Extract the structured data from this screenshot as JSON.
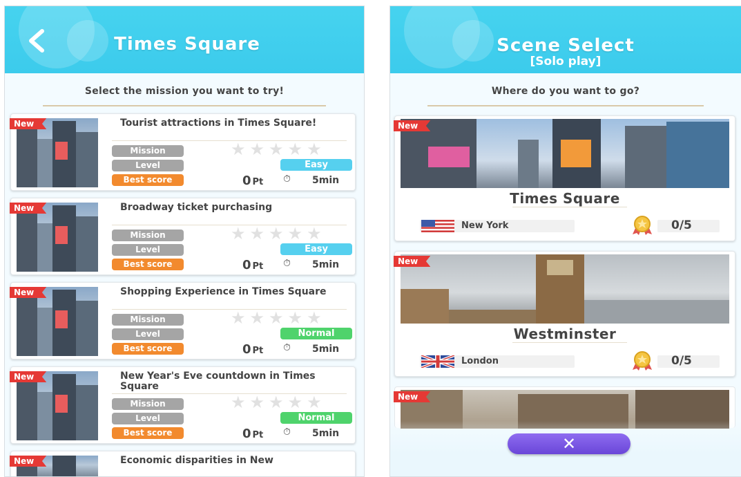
{
  "left_screen": {
    "title": "Times Square",
    "back_icon": "chevron-left-icon",
    "prompt": "Select the mission you want to try!",
    "labels": {
      "mission": "Mission",
      "level": "Level",
      "best_score": "Best score",
      "points_unit": "Pt"
    },
    "new_badge": "New",
    "missions": [
      {
        "title": "Tourist attractions in Times Square!",
        "difficulty": "Easy",
        "score": "0",
        "duration": "5min",
        "stars": 0
      },
      {
        "title": "Broadway ticket purchasing",
        "difficulty": "Easy",
        "score": "0",
        "duration": "5min",
        "stars": 0
      },
      {
        "title": "Shopping Experience in Times Square",
        "difficulty": "Normal",
        "score": "0",
        "duration": "5min",
        "stars": 0
      },
      {
        "title": "New Year's Eve countdown in Times Square",
        "difficulty": "Normal",
        "score": "0",
        "duration": "5min",
        "stars": 0
      },
      {
        "title": "Economic disparities in New"
      }
    ],
    "colors": {
      "header": "#46d3ef",
      "easy": "#56d0ef",
      "normal": "#4fd36c",
      "best_score": "#f28a2e",
      "new_badge": "#e53935"
    }
  },
  "right_screen": {
    "title": "Scene Select",
    "subtitle": "[Solo play]",
    "prompt": "Where do you want to go?",
    "new_badge": "New",
    "scenes": [
      {
        "name": "Times Square",
        "city": "New York",
        "flag": "us-flag-icon",
        "progress": "0/5"
      },
      {
        "name": "Westminster",
        "city": "London",
        "flag": "uk-flag-icon",
        "progress": "0/5"
      },
      {
        "name": ""
      }
    ],
    "close_icon": "close-icon",
    "close_label": "✕",
    "colors": {
      "close_button": "#7b59e4",
      "medal": "#f5c542"
    }
  }
}
